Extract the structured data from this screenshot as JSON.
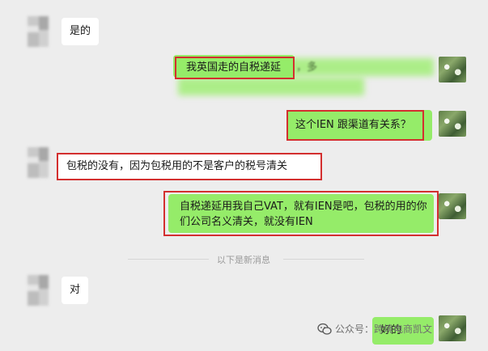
{
  "messages": [
    {
      "side": "left",
      "text": "是的"
    },
    {
      "side": "right",
      "text": "我英国走的自税递延",
      "suffix": "，多"
    },
    {
      "side": "right",
      "text": "这个IEN  跟渠道有关系？"
    },
    {
      "side": "left",
      "text": "包税的没有，因为包税用的不是客户的税号清关"
    },
    {
      "side": "right",
      "text": "自税递延用我自己VAT，就有IEN是吧，包税的用的你们公司名义清关，就没有IEN"
    },
    {
      "side": "left",
      "text": "对"
    },
    {
      "side": "right",
      "text": "好的"
    }
  ],
  "divider": "以下是新消息",
  "watermark": {
    "icon": "wechat-icon",
    "text": "公众号：跨境电商凯文"
  },
  "colors": {
    "bg": "#ededed",
    "green_bubble": "#95ec69",
    "white_bubble": "#ffffff",
    "highlight_box": "#d32f2f"
  }
}
